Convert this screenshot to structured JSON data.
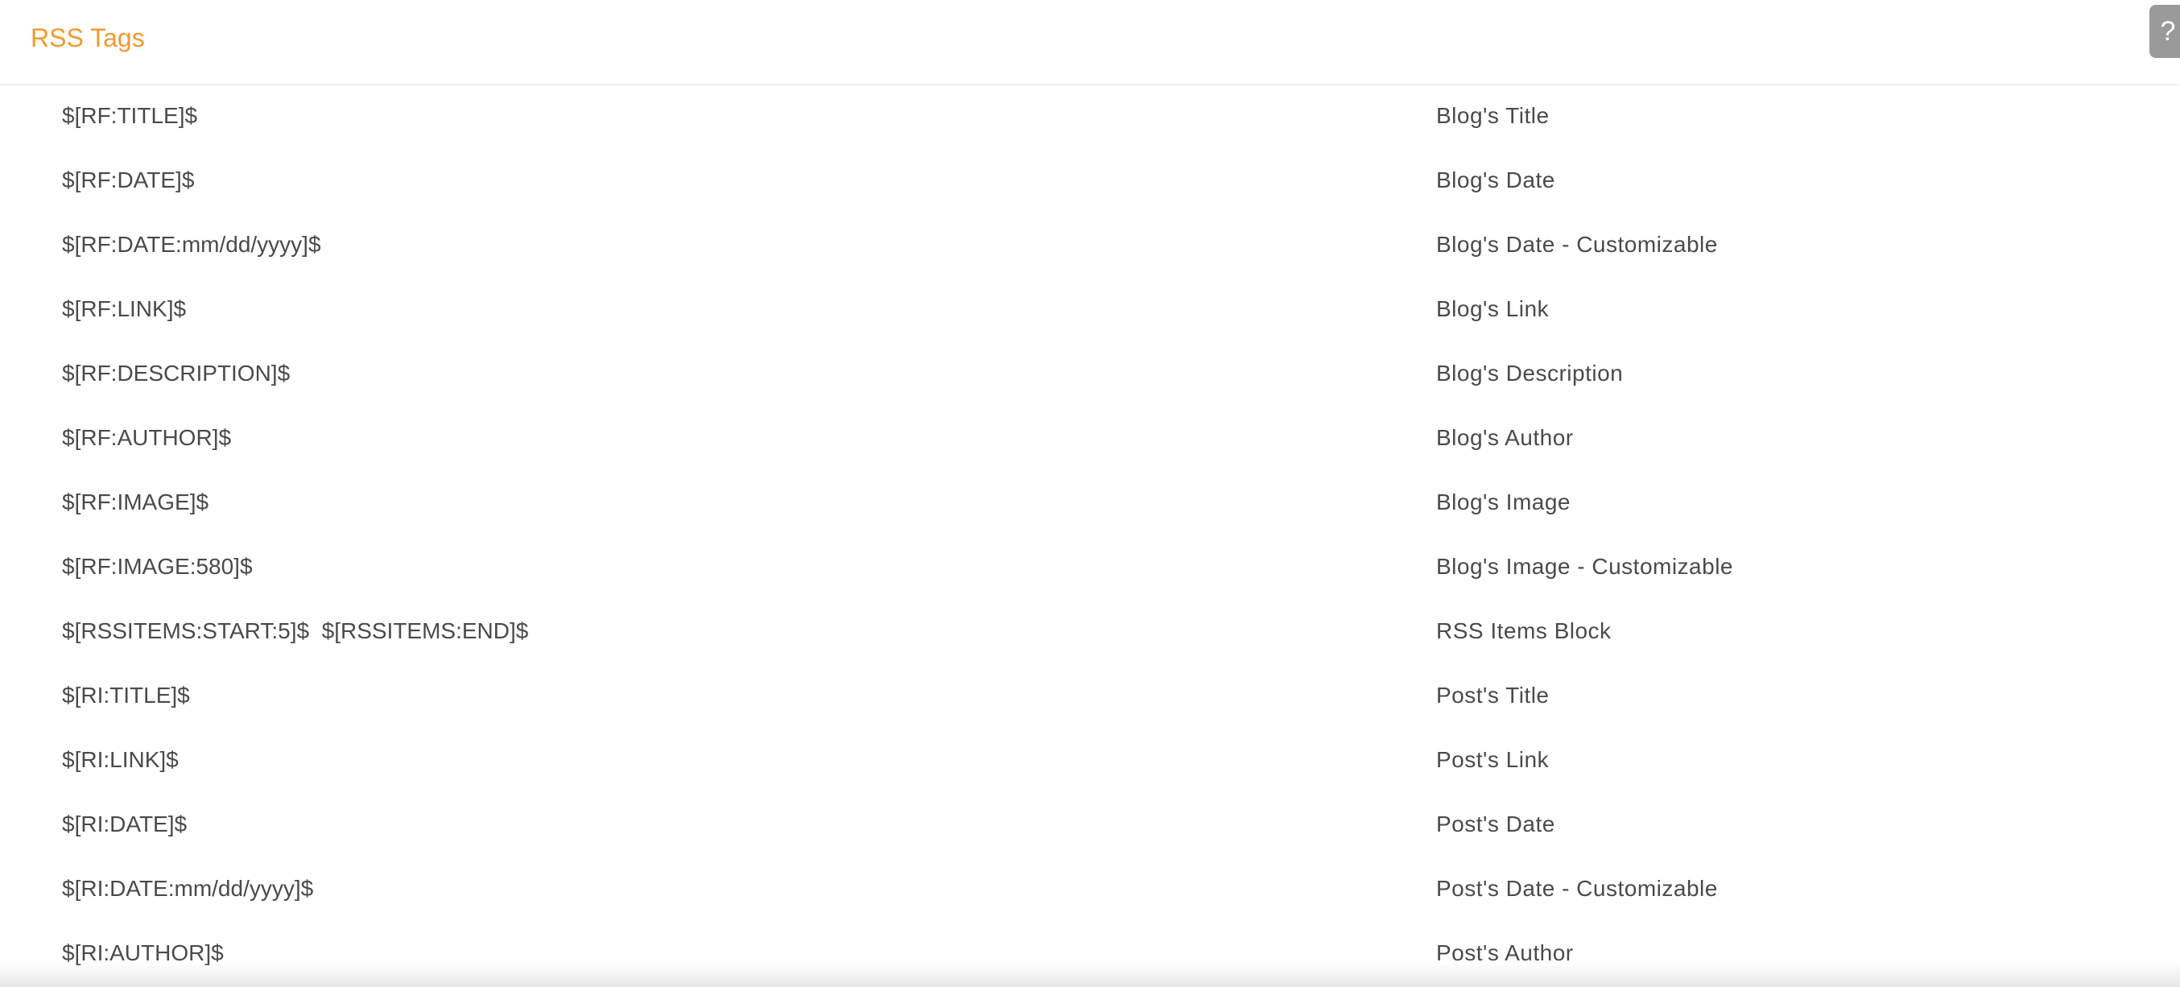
{
  "header": {
    "title": "RSS Tags",
    "help_label": "?"
  },
  "rows": [
    {
      "tag": "$[RF:TITLE]$",
      "desc": "Blog's Title"
    },
    {
      "tag": "$[RF:DATE]$",
      "desc": "Blog's Date"
    },
    {
      "tag": "$[RF:DATE:mm/dd/yyyy]$",
      "desc": "Blog's Date - Customizable"
    },
    {
      "tag": "$[RF:LINK]$",
      "desc": "Blog's Link"
    },
    {
      "tag": "$[RF:DESCRIPTION]$",
      "desc": "Blog's Description"
    },
    {
      "tag": "$[RF:AUTHOR]$",
      "desc": "Blog's Author"
    },
    {
      "tag": "$[RF:IMAGE]$",
      "desc": "Blog's Image"
    },
    {
      "tag": "$[RF:IMAGE:580]$",
      "desc": "Blog's Image - Customizable"
    },
    {
      "tag": "$[RSSITEMS:START:5]$  $[RSSITEMS:END]$",
      "desc": "RSS Items Block"
    },
    {
      "tag": "$[RI:TITLE]$",
      "desc": "Post's Title"
    },
    {
      "tag": "$[RI:LINK]$",
      "desc": "Post's Link"
    },
    {
      "tag": "$[RI:DATE]$",
      "desc": "Post's Date"
    },
    {
      "tag": "$[RI:DATE:mm/dd/yyyy]$",
      "desc": "Post's Date - Customizable"
    },
    {
      "tag": "$[RI:AUTHOR]$",
      "desc": "Post's Author"
    }
  ]
}
